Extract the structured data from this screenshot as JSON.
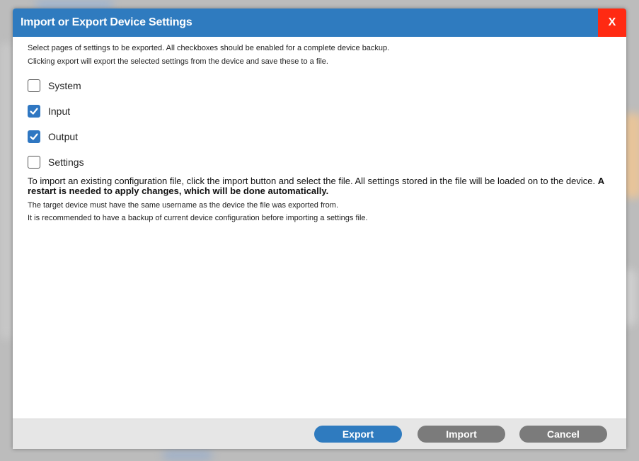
{
  "dialog": {
    "title": "Import or Export Device Settings",
    "close_label": "X"
  },
  "intro": {
    "line1": "Select pages of settings to be exported. All checkboxes should be enabled for a complete device backup.",
    "line2": "Clicking export will export the selected settings from the device and save these to a file."
  },
  "checkboxes": [
    {
      "label": "System",
      "checked": false
    },
    {
      "label": "Input",
      "checked": true
    },
    {
      "label": "Output",
      "checked": true
    },
    {
      "label": "Settings",
      "checked": false
    }
  ],
  "import_info": {
    "text": "To import an existing configuration file, click the import button and select the file. All settings stored in the file will be loaded on to the device.",
    "bold_text": "A restart is needed to apply changes, which will be done automatically.",
    "note1": "The target device must have the same username as the device the file was exported from.",
    "note2": "It is recommended to have a backup of current device configuration before importing a settings file."
  },
  "buttons": {
    "export": "Export",
    "import": "Import",
    "cancel": "Cancel"
  },
  "colors": {
    "title_bar": "#2f7bbf",
    "close_button": "#ff2a12",
    "checkbox_checked": "#2f77c2",
    "secondary_button": "#7b7b7b"
  }
}
